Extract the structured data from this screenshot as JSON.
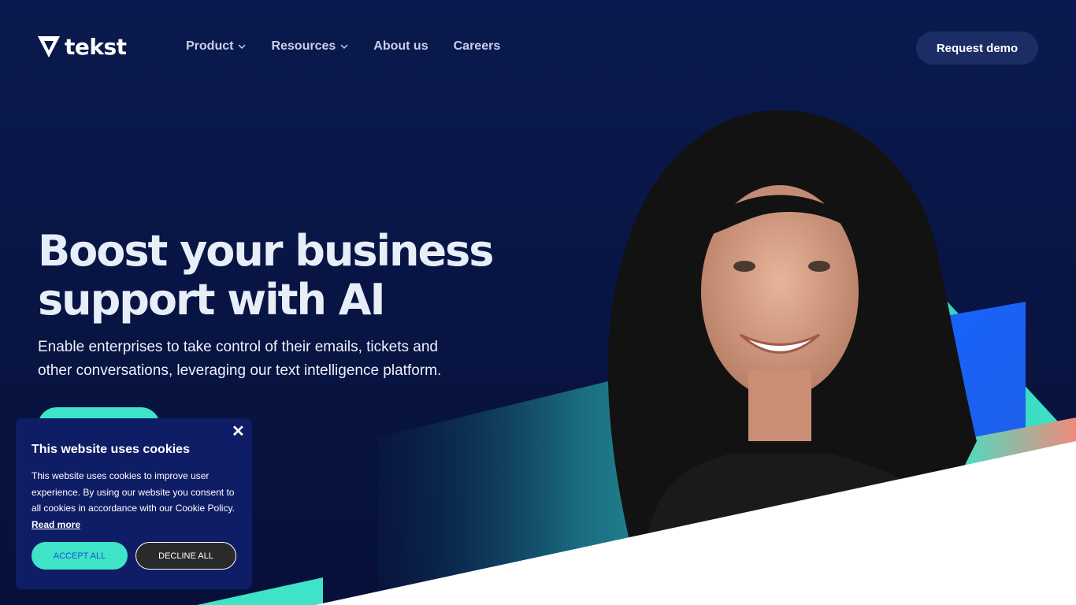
{
  "brand": {
    "name": "tekst",
    "logo_icon": "tekst-logo-icon"
  },
  "nav": {
    "items": [
      {
        "label": "Product",
        "has_dropdown": true
      },
      {
        "label": "Resources",
        "has_dropdown": true
      },
      {
        "label": "About us",
        "has_dropdown": false
      },
      {
        "label": "Careers",
        "has_dropdown": false
      }
    ],
    "cta_label": "Request demo"
  },
  "hero": {
    "title_line1": "Boost your business",
    "title_line2": "support with AI",
    "subtitle_line1": "Enable enterprises to take control of their emails, tickets and",
    "subtitle_line2": "other conversations, leveraging our text intelligence platform."
  },
  "cookie_banner": {
    "title": "This website uses cookies",
    "body": "This website uses cookies to improve user experience. By using our website you consent to all cookies in accordance with our Cookie Policy.",
    "read_more": "Read more",
    "accept_label": "ACCEPT ALL",
    "decline_label": "DECLINE ALL",
    "close_icon": "close-icon"
  },
  "colors": {
    "background": "#081442",
    "accent_teal": "#3fe3c7",
    "accent_blue": "#1f6bff",
    "accent_coral": "#f08a7a",
    "button_dark": "#1c2c64",
    "cookie_bg": "#0e1d66"
  }
}
